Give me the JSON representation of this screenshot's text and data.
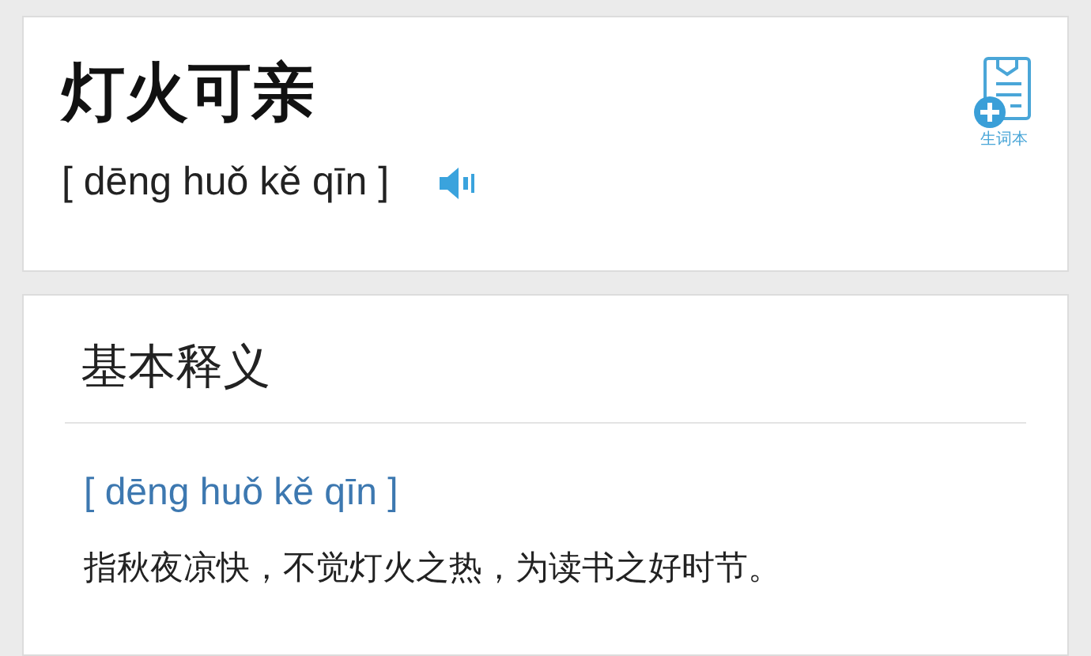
{
  "word": {
    "title": "灯火可亲",
    "pinyin": "[ dēng huǒ kě qīn ]",
    "vocab_button": "生词本"
  },
  "definition": {
    "heading": "基本释义",
    "pinyin": "[ dēng huǒ kě qīn ]",
    "text": "指秋夜凉快，不觉灯火之热，为读书之好时节。"
  }
}
